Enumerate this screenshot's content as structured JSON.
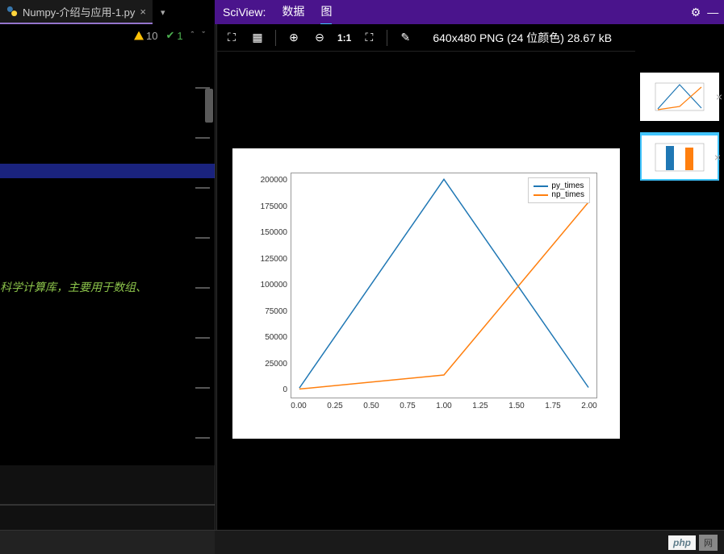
{
  "editor": {
    "tab_name": "Numpy-介绍与应用-1.py",
    "warnings_count": "10",
    "pass_count": "1",
    "code_snippet": "科学计算库，主要用于数组、"
  },
  "sciview": {
    "label": "SciView:",
    "tab_data": "数据",
    "tab_plot": "图"
  },
  "toolbar": {
    "ratio": "1:1",
    "image_info": "640x480 PNG (24 位颜色) 28.67 kB"
  },
  "chart_data": {
    "type": "line",
    "x": [
      0.0,
      1.0,
      2.0
    ],
    "series": [
      {
        "name": "py_times",
        "values": [
          1500,
          202000,
          2000
        ],
        "color": "#1f77b4"
      },
      {
        "name": "np_times",
        "values": [
          500,
          14000,
          180000
        ],
        "color": "#ff7f0e"
      }
    ],
    "xlabel": "",
    "ylabel": "",
    "xlim": [
      0.0,
      2.0
    ],
    "ylim": [
      0,
      200000
    ],
    "xticks": [
      "0.00",
      "0.25",
      "0.50",
      "0.75",
      "1.00",
      "1.25",
      "1.50",
      "1.75",
      "2.00"
    ],
    "yticks": [
      "0",
      "25000",
      "50000",
      "75000",
      "100000",
      "125000",
      "150000",
      "175000",
      "200000"
    ]
  },
  "footer": {
    "php_label": "php",
    "cn_label": "网"
  }
}
